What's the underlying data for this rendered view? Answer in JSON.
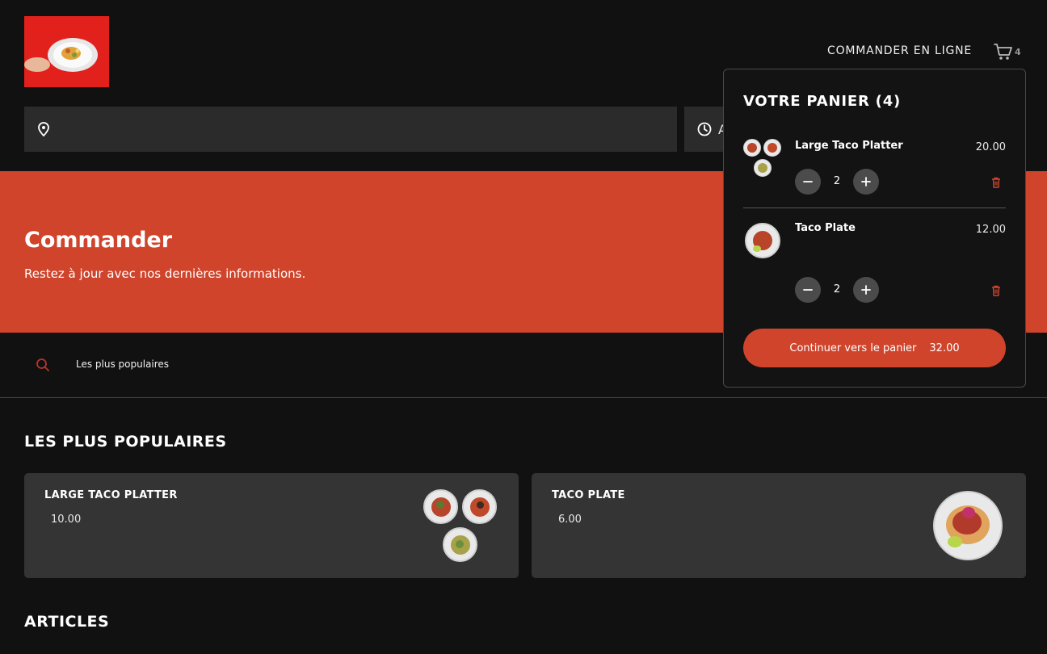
{
  "header": {
    "nav_order_online": "COMMANDER EN LIGNE",
    "cart_count": "4"
  },
  "search_bar": {
    "address_placeholder": "",
    "time_label": "A"
  },
  "hero": {
    "title": "Commander",
    "subtitle": "Restez à jour avec nos dernières informations."
  },
  "filters": {
    "active_label": "Les plus populaires"
  },
  "sections": {
    "popular_title": "LES PLUS POPULAIRES",
    "articles_title": "ARTICLES"
  },
  "menu_items": [
    {
      "name": "LARGE TACO PLATTER",
      "price": "10.00"
    },
    {
      "name": "TACO PLATE",
      "price": "6.00"
    }
  ],
  "cart_popup": {
    "title": "VOTRE PANIER (4)",
    "items": [
      {
        "name": "Large Taco Platter",
        "price": "20.00",
        "quantity": "2"
      },
      {
        "name": "Taco Plate",
        "price": "12.00",
        "quantity": "2"
      }
    ],
    "checkout_label": "Continuer vers le panier",
    "checkout_total": "32.00"
  },
  "colors": {
    "background": "#111112",
    "accent": "#d0442c",
    "card": "#343434",
    "field": "#2b2b2b",
    "logo_bg": "#e3211c"
  },
  "icons": [
    "location-pin-icon",
    "clock-icon",
    "cart-icon",
    "search-icon",
    "minus-icon",
    "plus-icon",
    "trash-icon"
  ]
}
